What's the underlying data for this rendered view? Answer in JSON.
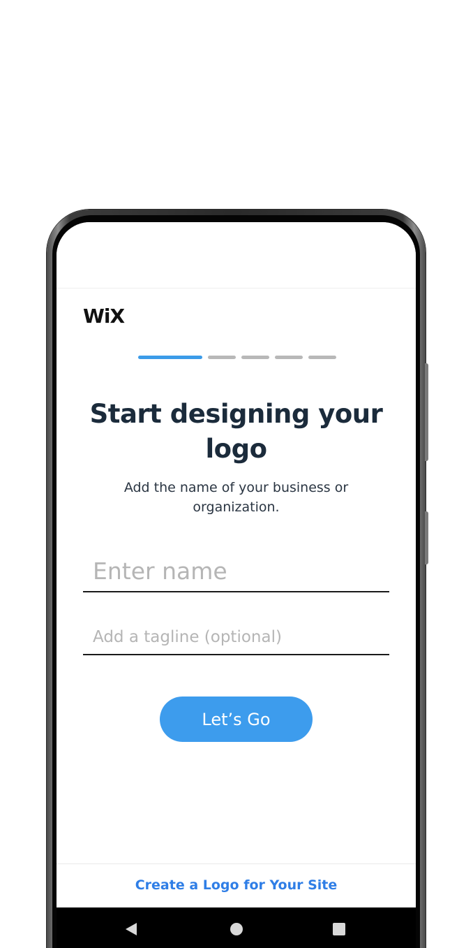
{
  "app": {
    "logo_text": "WiX"
  },
  "progress": {
    "total_steps": 5,
    "current_step": 1
  },
  "main": {
    "title": "Start designing your logo",
    "subtitle": "Add the name of your business or organization.",
    "name_input": {
      "value": "",
      "placeholder": "Enter name"
    },
    "tagline_input": {
      "value": "",
      "placeholder": "Add a tagline (optional)"
    },
    "cta_label": "Let’s Go"
  },
  "footer": {
    "link_label": "Create a Logo for Your Site"
  },
  "colors": {
    "accent": "#3d9ced",
    "link": "#2f7ee6",
    "title": "#1b2b3b",
    "progress_inactive": "#b8b8b8"
  },
  "icons": {
    "back": "triangle-back-icon",
    "home": "circle-home-icon",
    "recents": "square-recents-icon"
  }
}
